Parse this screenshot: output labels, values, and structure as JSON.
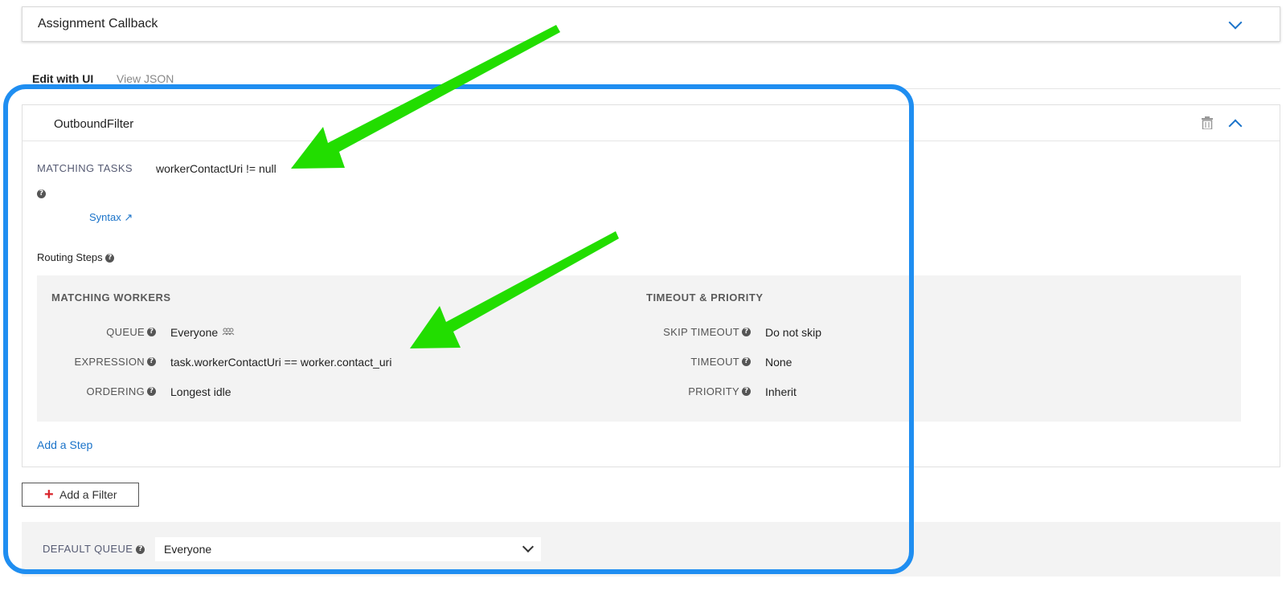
{
  "assignment_callback": {
    "title": "Assignment Callback"
  },
  "tabs": [
    {
      "label": "Edit with UI"
    },
    {
      "label": "View JSON"
    }
  ],
  "filter": {
    "name": "OutboundFilter",
    "matching_tasks_label": "MATCHING TASKS",
    "matching_tasks_value": "workerContactUri != null",
    "syntax_link": "Syntax ↗",
    "routing_steps_label": "Routing Steps",
    "matching_workers_heading": "MATCHING WORKERS",
    "timeout_priority_heading": "TIMEOUT & PRIORITY",
    "queue_label": "QUEUE",
    "queue_value": "Everyone",
    "expression_label": "EXPRESSION",
    "expression_value": "task.workerContactUri == worker.contact_uri",
    "ordering_label": "ORDERING",
    "ordering_value": "Longest idle",
    "skip_timeout_label": "SKIP TIMEOUT",
    "skip_timeout_value": "Do not skip",
    "timeout_label": "TIMEOUT",
    "timeout_value": "None",
    "priority_label": "PRIORITY",
    "priority_value": "Inherit",
    "add_step": "Add a Step"
  },
  "add_filter_label": "Add a Filter",
  "default_queue": {
    "label": "DEFAULT QUEUE",
    "value": "Everyone"
  },
  "colors": {
    "accent": "#1a73c9",
    "highlight": "#1f8ef1",
    "arrow": "#22dd00",
    "plus": "#d8232a"
  },
  "icons": [
    "chevron-down-icon",
    "chevron-up-icon",
    "trash-icon",
    "help-icon",
    "people-icon",
    "external-link-icon",
    "plus-icon"
  ]
}
